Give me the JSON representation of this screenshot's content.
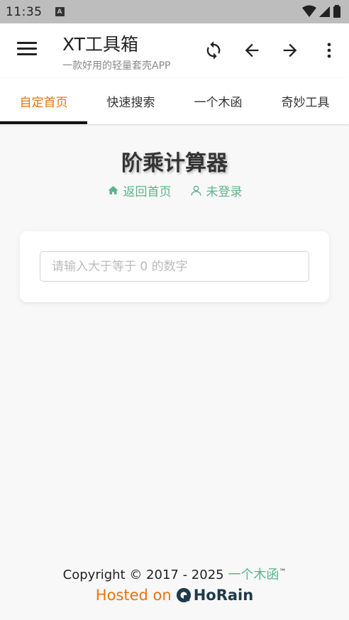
{
  "status_bar": {
    "time": "11:35",
    "notification_icon": "A"
  },
  "app_bar": {
    "title": "XT工具箱",
    "subtitle": "一款好用的轻量套壳APP",
    "icons": [
      "menu-icon",
      "refresh-icon",
      "arrow-back-icon",
      "arrow-forward-icon",
      "more-vert-icon"
    ]
  },
  "tabs": [
    {
      "label": "自定首页",
      "active": true
    },
    {
      "label": "快速搜索",
      "active": false
    },
    {
      "label": "一个木函",
      "active": false
    },
    {
      "label": "奇妙工具",
      "active": false
    }
  ],
  "page": {
    "title": "阶乘计算器",
    "home_link": "返回首页",
    "login_link": "未登录",
    "input_placeholder": "请输入大于等于 0 的数字",
    "input_value": ""
  },
  "footer": {
    "copyright": "Copyright © 2017 - 2025 ",
    "brand": "一个木函",
    "tm": "™",
    "hosted_on": "Hosted on",
    "host_name": "HoRain"
  },
  "colors": {
    "accent": "#e8730f",
    "link": "#5bb58a",
    "status_bar": "#bdbdbd"
  }
}
